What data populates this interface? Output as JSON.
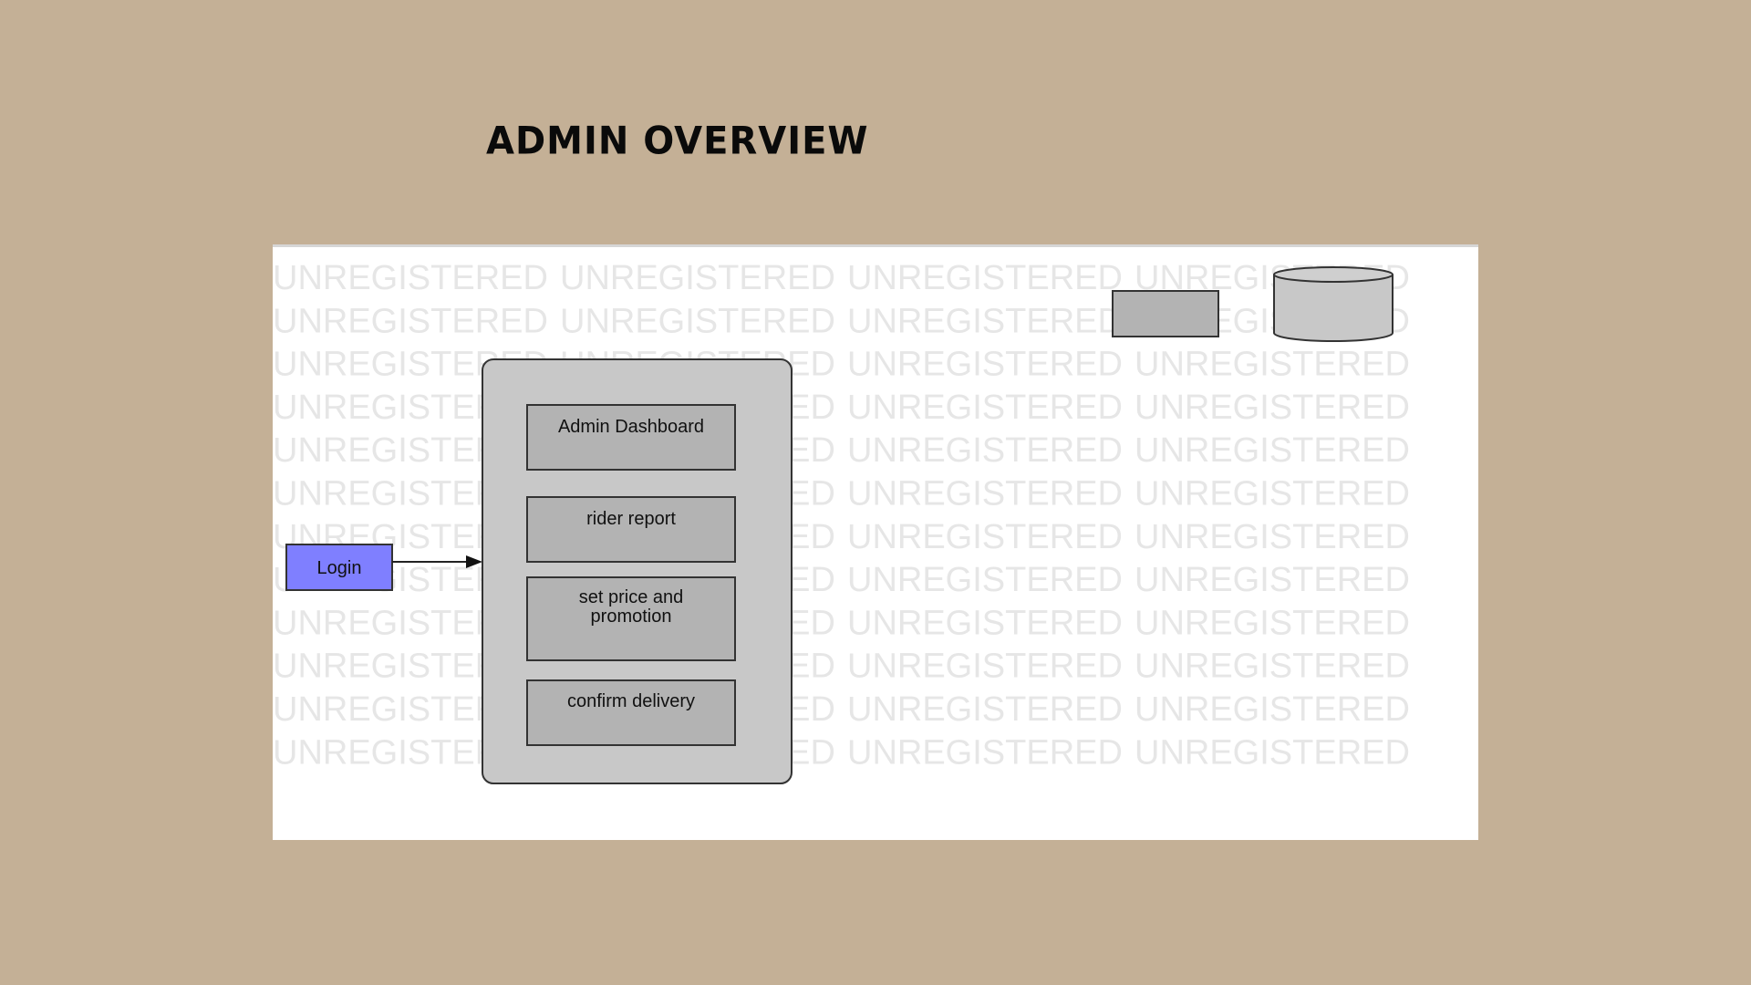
{
  "slide": {
    "title": "ADMIN OVERVIEW"
  },
  "diagram": {
    "watermark": "UNREGISTERED",
    "login_label": "Login",
    "modules": [
      {
        "line1": "Admin Dashboard",
        "line2": ""
      },
      {
        "line1": "rider report",
        "line2": ""
      },
      {
        "line1": "set price and",
        "line2": "promotion"
      },
      {
        "line1": "confirm delivery",
        "line2": ""
      }
    ]
  },
  "colors": {
    "background": "#c4b096",
    "panel": "#ffffff",
    "login_fill": "#7f7fff",
    "container_fill": "#c8c8c8",
    "module_fill": "#b3b3b3",
    "watermark": "#e6e6e6"
  }
}
